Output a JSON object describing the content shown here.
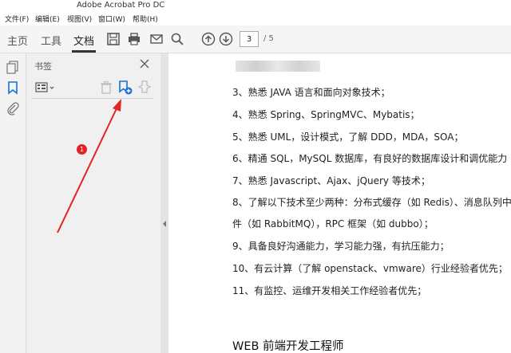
{
  "window": {
    "title": "Adobe Acrobat Pro DC"
  },
  "menu": [
    "文件(F)",
    "编辑(E)",
    "视图(V)",
    "窗口(W)",
    "帮助(H)"
  ],
  "tabs": [
    "主页",
    "工具",
    "文档"
  ],
  "toolbar": {
    "current_page": "3",
    "total_pages": "/ 5"
  },
  "bookmarks": {
    "title": "书签"
  },
  "annotation": {
    "badge": "1"
  },
  "document": {
    "lines": [
      "3、熟悉 JAVA 语言和面向对象技术；",
      "4、熟悉 Spring、SpringMVC、Mybatis；",
      "5、熟悉 UML，设计模式，了解 DDD，MDA，SOA；",
      "6、精通 SQL，MySQL 数据库，有良好的数据库设计和调优能力",
      "7、熟悉 Javascript、Ajax、jQuery 等技术；",
      "8、了解以下技术至少两种：分布式缓存（如 Redis）、消息队列中",
      "件（如 RabbitMQ），RPC 框架（如 dubbo）；",
      "9、具备良好沟通能力，学习能力强，有抗压能力；",
      "10、有云计算（了解 openstack、vmware）行业经验者优先；",
      "11、有监控、运维开发相关工作经验者优先；"
    ],
    "heading": "WEB 前端开发工程师"
  },
  "colors": {
    "accent_blue": "#1a6fd6",
    "annotation_red": "#e32424"
  }
}
